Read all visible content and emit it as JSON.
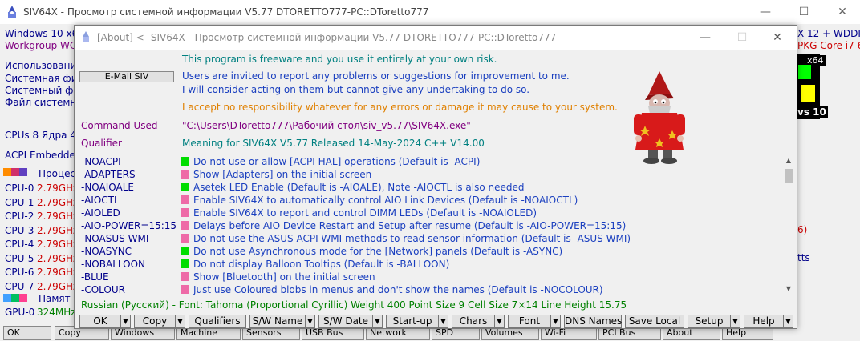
{
  "main_window": {
    "title": "SIV64X - Просмотр системной информации V5.77 DTORETTO777-PC::DToretto777",
    "lines": [
      {
        "text": "Windows 10 x6",
        "color": "blue"
      },
      {
        "text": "Workgroup WO",
        "color": "purple"
      },
      {
        "text": "Использование",
        "color": "blue"
      },
      {
        "text": "Системная физ",
        "color": "blue"
      },
      {
        "text": "Системный фай",
        "color": "blue"
      },
      {
        "text": "Файл системно",
        "color": "blue"
      },
      {
        "text": "CPUs 8 Ядра 4 (",
        "color": "blue"
      },
      {
        "text": "ACPI Embedded",
        "color": "blue"
      }
    ],
    "processes_label": "Процес",
    "cpus": [
      {
        "label": "CPU-0",
        "value": "2.79GHz"
      },
      {
        "label": "CPU-1",
        "value": "2.79GHz"
      },
      {
        "label": "CPU-2",
        "value": "2.79GHz"
      },
      {
        "label": "CPU-3",
        "value": "2.79GHz"
      },
      {
        "label": "CPU-4",
        "value": "2.79GHz"
      },
      {
        "label": "CPU-5",
        "value": "2.79GHz"
      },
      {
        "label": "CPU-6",
        "value": "2.79GHz"
      },
      {
        "label": "CPU-7",
        "value": "2.79GHz"
      }
    ],
    "memory_label": "Памят",
    "gpu_label": "GPU-0",
    "gpu_value": "324MHz",
    "right_top_1": "X 12 + WDDI",
    "right_top_2": "PKG Core i7 62",
    "right_x64": "x64",
    "right_ws": "vs 10",
    "right_mid_1": "6)",
    "right_mid_2": "tts",
    "bottom_buttons": [
      "OK",
      "Copy",
      "Windows",
      "Machine",
      "Sensors",
      "USB Bus",
      "Network",
      "SPD",
      "Volumes",
      "Wi-Fi",
      "PCI Bus",
      "About",
      "Help"
    ]
  },
  "dialog": {
    "title": "[About] <- SIV64X - Просмотр системной информации V5.77 DTORETTO777-PC::DToretto777",
    "freeware": "This program is freeware and you use it entirely at your own risk.",
    "email_button": "E-Mail SIV",
    "invite_1": "Users are invited to report any problems or suggestions for improvement to me.",
    "invite_2": "I will consider acting on them but cannot give any undertaking to do so.",
    "disclaimer": "I accept no responsibility whatever for any errors or damage it may cause to your system.",
    "command_label": "Command Used",
    "command_value": "\"C:\\Users\\DToretto777\\Рабочий стол\\siv_v5.77\\SIV64X.exe\"",
    "qualifier_label": "Qualifier",
    "qualifier_value": "Meaning for SIV64X V5.77  Released 14-May-2024 C++ V14.00",
    "options": [
      {
        "name": "-NOACPI",
        "blob": "#00dd00",
        "desc": "Do not use or allow [ACPI HAL] operations (Default is -ACPI)"
      },
      {
        "name": "-ADAPTERS",
        "blob": "#ee6aa7",
        "desc": "Show [Adapters] on the initial screen"
      },
      {
        "name": "-NOAIOALE",
        "blob": "#00dd00",
        "desc": "Asetek LED Enable (Default is -AIOALE), Note -AIOCTL is also needed"
      },
      {
        "name": "-AIOCTL",
        "blob": "#ee6aa7",
        "desc": "Enable SIV64X to automatically control AIO Link Devices (Default is -NOAIOCTL)"
      },
      {
        "name": "-AIOLED",
        "blob": "#ee6aa7",
        "desc": "Enable SIV64X to report and control DIMM LEDs (Default is -NOAIOLED)"
      },
      {
        "name": "-AIO-POWER=15:15",
        "blob": "#ee6aa7",
        "desc": "Delays before AIO Device Restart and Setup after resume (Default is -AIO-POWER=15:15)"
      },
      {
        "name": "-NOASUS-WMI",
        "blob": "#ee6aa7",
        "desc": "Do not use the ASUS ACPI WMI methods to read sensor information (Default is -ASUS-WMI)"
      },
      {
        "name": "-NOASYNC",
        "blob": "#00dd00",
        "desc": "Do not use Asynchronous mode for the [Network] panels (Default is -ASYNC)"
      },
      {
        "name": "-NOBALLOON",
        "blob": "#00dd00",
        "desc": "Do not display Balloon Tooltips (Default is -BALLOON)"
      },
      {
        "name": "-BLUE",
        "blob": "#ee6aa7",
        "desc": "Show [Bluetooth] on the initial screen"
      },
      {
        "name": "-COLOUR",
        "blob": "#ee6aa7",
        "desc": "Just use Coloured blobs in menus and don't show the names (Default is -NOCOLOUR)"
      }
    ],
    "font_line": "Russian (Русский) - Font: Tahoma (Proportional Cyrillic)  Weight 400  Point Size 9  Cell Size 7×14  Line Height 15.75",
    "buttons": [
      "OK",
      "Copy",
      "Qualifiers",
      "S/W Name",
      "S/W Date",
      "Start-up",
      "Chars",
      "Font",
      "DNS Names",
      "Save Local",
      "Setup",
      "Help"
    ]
  }
}
